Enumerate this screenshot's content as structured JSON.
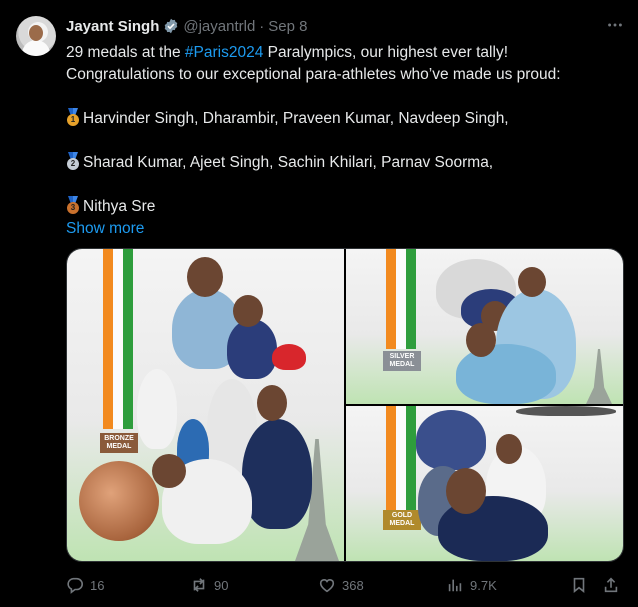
{
  "tweet": {
    "author_name": "Jayant Singh",
    "handle": "@jayantrld",
    "separator": "·",
    "date": "Sep 8",
    "more_icon": "more-icon",
    "lines": {
      "l1_pre": "29 medals at the ",
      "l1_hashtag": "#Paris2024",
      "l1_post": " Paralympics, our highest ever tally!",
      "l2": "Congratulations to our exceptional para-athletes who’ve made us proud:",
      "gold": "Harvinder Singh,  Dharambir,  Praveen Kumar,  Navdeep Singh,",
      "silver": "Sharad Kumar,  Ajeet Singh,  Sachin Khilari,  Parnav Soorma,",
      "bronze": "Nithya Sre"
    },
    "medal_numbers": {
      "gold": "1",
      "silver": "2",
      "bronze": "3"
    },
    "show_more": "Show more"
  },
  "media": {
    "panel1_label": "BRONZE MEDAL",
    "panel2_label": "SILVER MEDAL",
    "panel3_label": "GOLD MEDAL"
  },
  "actions": {
    "replies": "16",
    "reposts": "90",
    "likes": "368",
    "views": "9.7K"
  },
  "colors": {
    "background": "#000000",
    "text": "#e7e9ea",
    "muted": "#71767b",
    "accent": "#1d9bf0",
    "saffron": "#f28a1f",
    "india_green": "#2e9d3c"
  }
}
